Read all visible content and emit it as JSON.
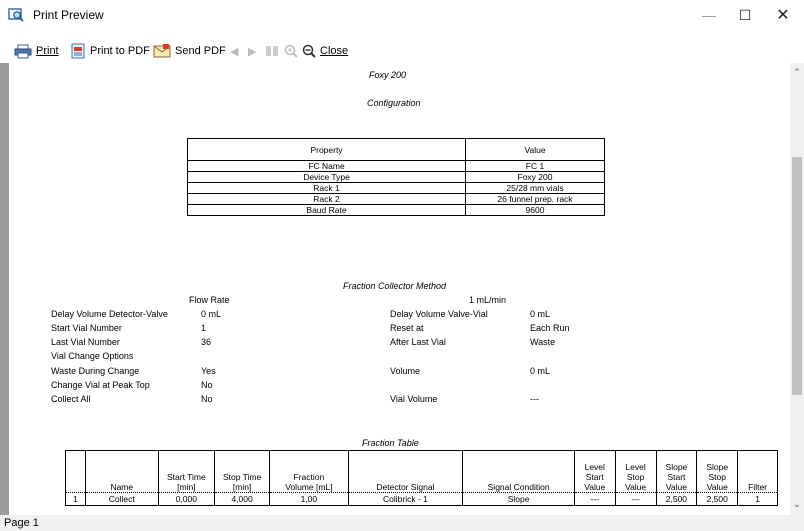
{
  "window": {
    "title": "Print Preview",
    "minimize": "—",
    "maximize": "☐",
    "close": "✕"
  },
  "toolbar": {
    "print_label": "Print",
    "print_pdf_label": "Print to PDF",
    "send_pdf_label": "Send PDF",
    "close_label": "Close"
  },
  "document": {
    "device_title": "Foxy 200",
    "configuration_heading": "Configuration",
    "config_headers": [
      "Property",
      "Value"
    ],
    "config_rows": [
      [
        "FC Name",
        "FC 1"
      ],
      [
        "Device Type",
        "Foxy 200"
      ],
      [
        "Rack 1",
        "25/28  mm vials"
      ],
      [
        "Rack 2",
        "26 funnel prep. rack"
      ],
      [
        "Baud Rate",
        "9600"
      ]
    ],
    "method_heading": "Fraction Collector Method",
    "flow_rate_label": "Flow Rate",
    "flow_rate_value": "1 mL/min",
    "method_left": [
      [
        "Delay Volume Detector-Valve",
        "0 mL"
      ],
      [
        "Start Vial Number",
        "1"
      ],
      [
        "Last Vial Number",
        "36"
      ],
      [
        "Vial Change Options",
        ""
      ],
      [
        "Waste During Change",
        "Yes"
      ],
      [
        "Change Vial at Peak Top",
        "No"
      ],
      [
        "Collect All",
        "No"
      ]
    ],
    "method_right": [
      [
        "Delay Volume Valve-Vial",
        "0 mL"
      ],
      [
        "Reset at",
        "Each Run"
      ],
      [
        "After Last Vial",
        "Waste"
      ],
      [
        "Volume",
        "0 mL"
      ],
      [
        "Vial Volume",
        "---"
      ]
    ],
    "fraction_table_heading": "Fraction Table",
    "fraction_headers": [
      "",
      "Name",
      "Start Time\n[min]",
      "Stop Time\n[min]",
      "Fraction\nVolume [mL]",
      "Detector Signal",
      "Signal Condition",
      "Level\nStart\nValue",
      "Level\nStop\nValue",
      "Slope\nStart\nValue",
      "Slope\nStop\nValue",
      "Filter"
    ],
    "fraction_rows": [
      [
        "1",
        "Collect",
        "0,000",
        "4,000",
        "1,00",
        "Colibrick - 1",
        "Slope",
        "---",
        "---",
        "2,500",
        "2,500",
        "1"
      ]
    ]
  },
  "status": {
    "page_label": "Page 1"
  }
}
